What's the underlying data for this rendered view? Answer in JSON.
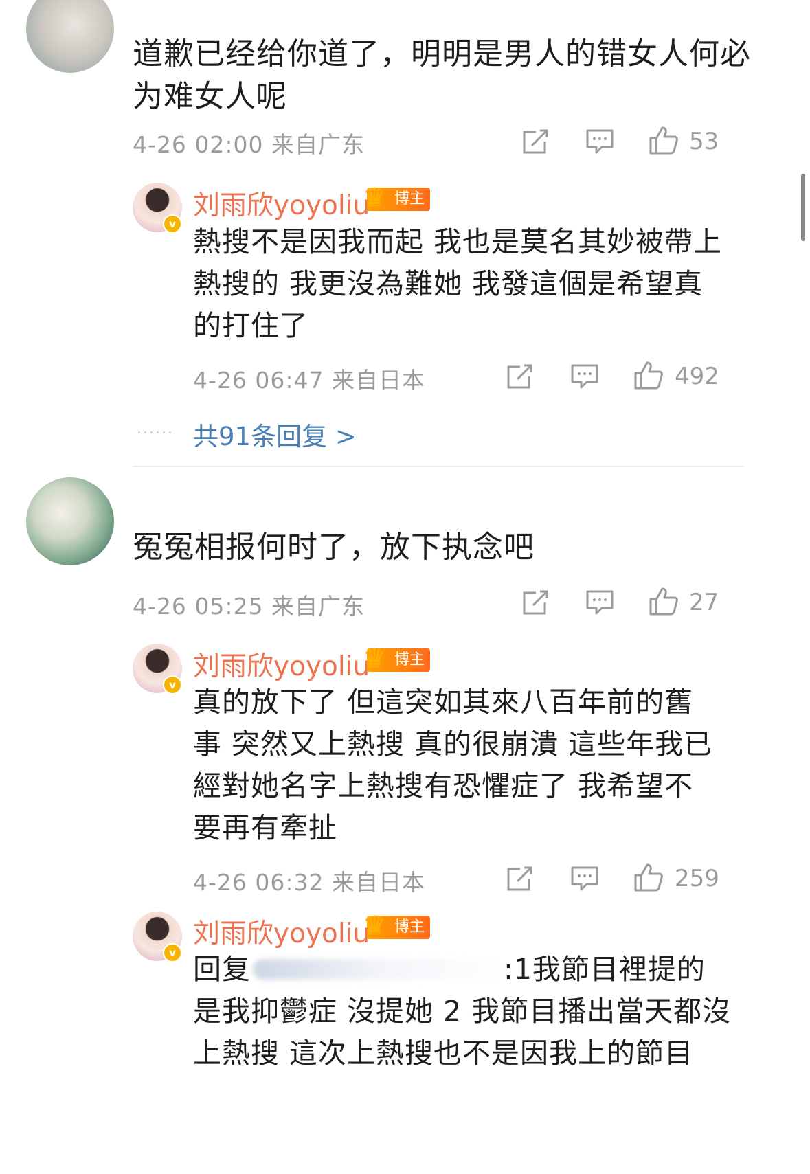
{
  "comments": [
    {
      "text_line1": "道歉已经给你道了，明明是男人的错女人何必",
      "text_line2": "为难女人呢",
      "date": "4-26 02:00",
      "location": "来自广东",
      "likes": "53",
      "replies": [
        {
          "author": "刘雨欣yoyoliu",
          "badge": "博主",
          "lines": [
            "熱搜不是因我而起 我也是莫名其妙被帶上",
            "熱搜的 我更沒為難她  我發這個是希望真",
            "的打住了"
          ],
          "date": "4-26 06:47",
          "location": "来自日本",
          "likes": "492"
        }
      ],
      "more_replies": "共91条回复 >"
    },
    {
      "text_line1": "冤冤相报何时了，放下执念吧",
      "date": "4-26 05:25",
      "location": "来自广东",
      "likes": "27",
      "replies": [
        {
          "author": "刘雨欣yoyoliu",
          "badge": "博主",
          "lines": [
            "真的放下了   但這突如其來八百年前的舊",
            "事 突然又上熱搜 真的很崩潰  這些年我已",
            "經對她名字上熱搜有恐懼症了   我希望不",
            "要再有牽扯"
          ],
          "date": "4-26 06:32",
          "location": "来自日本",
          "likes": "259"
        },
        {
          "author": "刘雨欣yoyoliu",
          "badge": "博主",
          "reply_prefix": "回复",
          "line1_tail": ":1我節目裡提的",
          "lines": [
            "是我抑鬱症 沒提她 2 我節目播出當天都沒",
            "上熱搜  這次上熱搜也不是因我上的節目"
          ]
        }
      ]
    }
  ],
  "icons": {
    "share": "share-icon",
    "comment": "comment-icon",
    "like": "thumbs-up-icon",
    "verified": "verified-badge-icon",
    "crown": "crown-icon"
  },
  "colors": {
    "author_name": "#eb7350",
    "link": "#4a7fb5",
    "meta": "#9b9b9b",
    "badge": "#ff8a10"
  }
}
